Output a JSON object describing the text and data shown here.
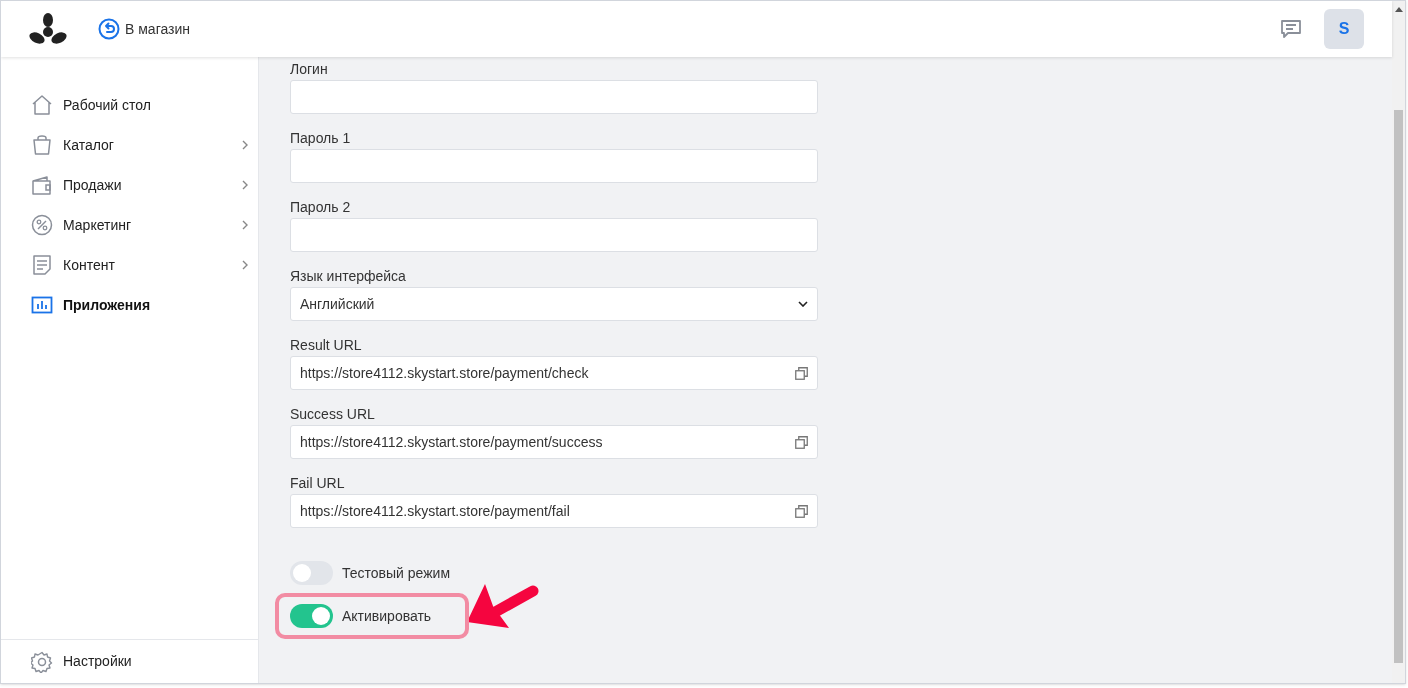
{
  "header": {
    "store_link": "В магазин",
    "avatar": "S"
  },
  "sidebar": {
    "items": [
      {
        "label": "Рабочий стол",
        "selected": false,
        "expandable": false
      },
      {
        "label": "Каталог",
        "selected": false,
        "expandable": true
      },
      {
        "label": "Продажи",
        "selected": false,
        "expandable": true
      },
      {
        "label": "Маркетинг",
        "selected": false,
        "expandable": true
      },
      {
        "label": "Контент",
        "selected": false,
        "expandable": true
      },
      {
        "label": "Приложения",
        "selected": true,
        "expandable": false
      }
    ],
    "footer_item": {
      "label": "Настройки"
    }
  },
  "form": {
    "fields": [
      {
        "kind": "text",
        "label": "Логин"
      },
      {
        "kind": "text",
        "label": "Пароль 1"
      },
      {
        "kind": "text",
        "label": "Пароль 2"
      },
      {
        "kind": "select",
        "label": "Язык интерфейса",
        "value": "Английский"
      },
      {
        "kind": "url",
        "label": "Result URL",
        "value": "https://store4112.skystart.store/payment/check"
      },
      {
        "kind": "url",
        "label": "Success URL",
        "value": "https://store4112.skystart.store/payment/success"
      },
      {
        "kind": "url",
        "label": "Fail URL",
        "value": "https://store4112.skystart.store/payment/fail"
      }
    ],
    "toggles": [
      {
        "label": "Тестовый режим",
        "on": false,
        "highlighted": false
      },
      {
        "label": "Активировать",
        "on": true,
        "highlighted": true
      }
    ]
  }
}
